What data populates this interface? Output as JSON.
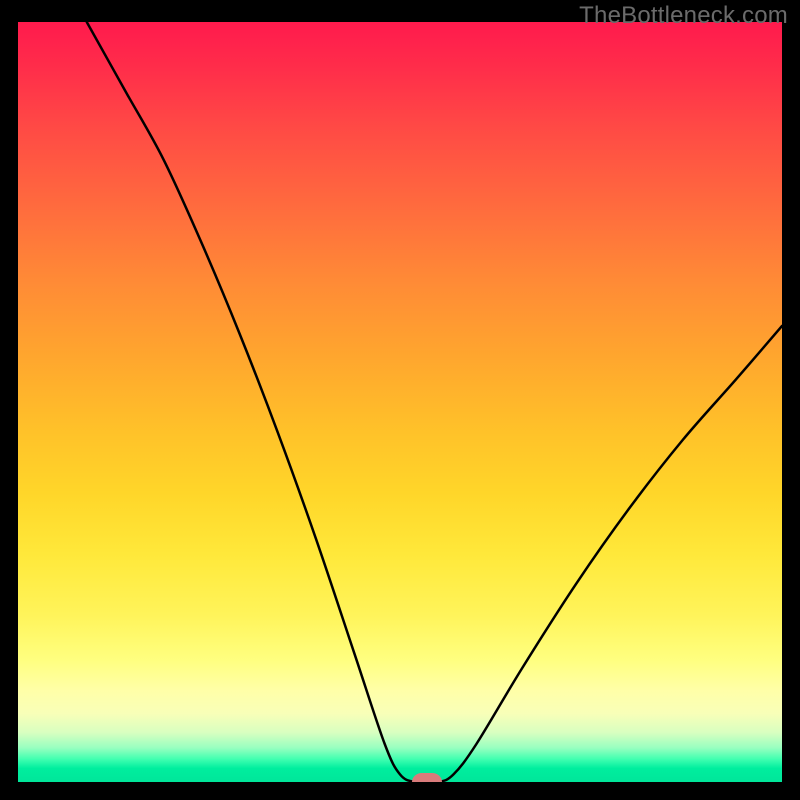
{
  "watermark": "TheBottleneck.com",
  "chart_data": {
    "type": "line",
    "title": "",
    "xlabel": "",
    "ylabel": "",
    "xlim": [
      0,
      100
    ],
    "ylim": [
      0,
      100
    ],
    "gradient_stops": [
      {
        "pct": 0,
        "color": "#ff1a4d"
      },
      {
        "pct": 14,
        "color": "#ff4a45"
      },
      {
        "pct": 34,
        "color": "#ff8a36"
      },
      {
        "pct": 54,
        "color": "#ffc229"
      },
      {
        "pct": 70,
        "color": "#ffe83a"
      },
      {
        "pct": 84,
        "color": "#ffff80"
      },
      {
        "pct": 93.5,
        "color": "#d8ffc0"
      },
      {
        "pct": 97,
        "color": "#40ffb0"
      },
      {
        "pct": 100,
        "color": "#00e69a"
      }
    ],
    "series": [
      {
        "name": "bottleneck-curve",
        "points": [
          {
            "x": 9,
            "y": 100
          },
          {
            "x": 14,
            "y": 91
          },
          {
            "x": 19,
            "y": 82
          },
          {
            "x": 24,
            "y": 71
          },
          {
            "x": 29,
            "y": 59
          },
          {
            "x": 34,
            "y": 46
          },
          {
            "x": 39,
            "y": 32
          },
          {
            "x": 44,
            "y": 17
          },
          {
            "x": 48,
            "y": 5
          },
          {
            "x": 50,
            "y": 1
          },
          {
            "x": 52,
            "y": 0
          },
          {
            "x": 55,
            "y": 0
          },
          {
            "x": 57,
            "y": 1
          },
          {
            "x": 60,
            "y": 5
          },
          {
            "x": 66,
            "y": 15
          },
          {
            "x": 73,
            "y": 26
          },
          {
            "x": 80,
            "y": 36
          },
          {
            "x": 87,
            "y": 45
          },
          {
            "x": 94,
            "y": 53
          },
          {
            "x": 100,
            "y": 60
          }
        ]
      }
    ],
    "marker": {
      "x": 53.5,
      "y": 0,
      "color": "#d97b7b"
    }
  }
}
